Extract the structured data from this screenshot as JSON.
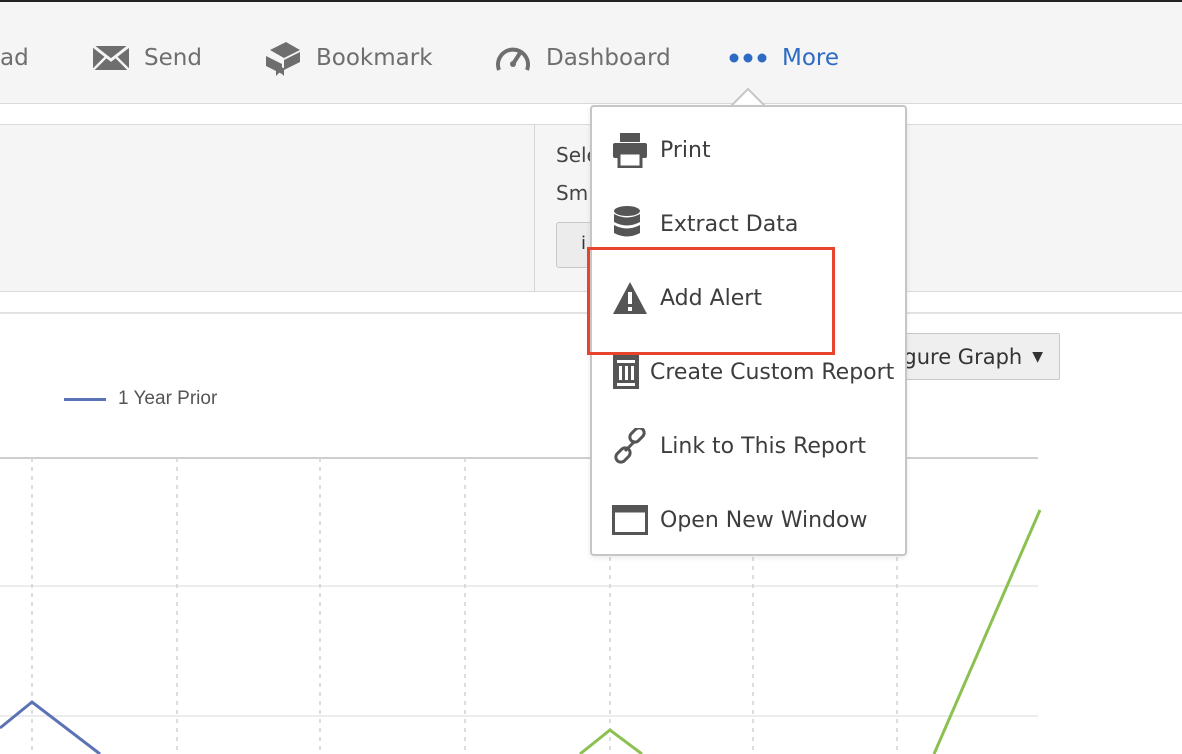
{
  "toolbar": {
    "download_partial": "ad",
    "send_label": "Send",
    "bookmark_label": "Bookmark",
    "dashboard_label": "Dashboard",
    "more_label": "More",
    "more_color": "#2d6bc4"
  },
  "panel": {
    "line1": "Sele",
    "line2": "Sm",
    "button_partial": "i"
  },
  "chart": {
    "legend_label": "1 Year Prior",
    "configure_button": "gure Graph",
    "series_colors": {
      "year_prior": "#5b72b5",
      "current": "#8cc152"
    }
  },
  "more_menu": {
    "items": [
      {
        "label": "Print",
        "icon": "printer-icon"
      },
      {
        "label": "Extract Data",
        "icon": "database-icon"
      },
      {
        "label": "Add Alert",
        "icon": "warning-icon"
      },
      {
        "label": "Create Custom Report",
        "icon": "report-icon"
      },
      {
        "label": "Link to This Report",
        "icon": "link-icon"
      },
      {
        "label": "Open New Window",
        "icon": "window-icon"
      }
    ],
    "highlighted_item": "Add Alert",
    "highlight_color": "#e8432c"
  }
}
